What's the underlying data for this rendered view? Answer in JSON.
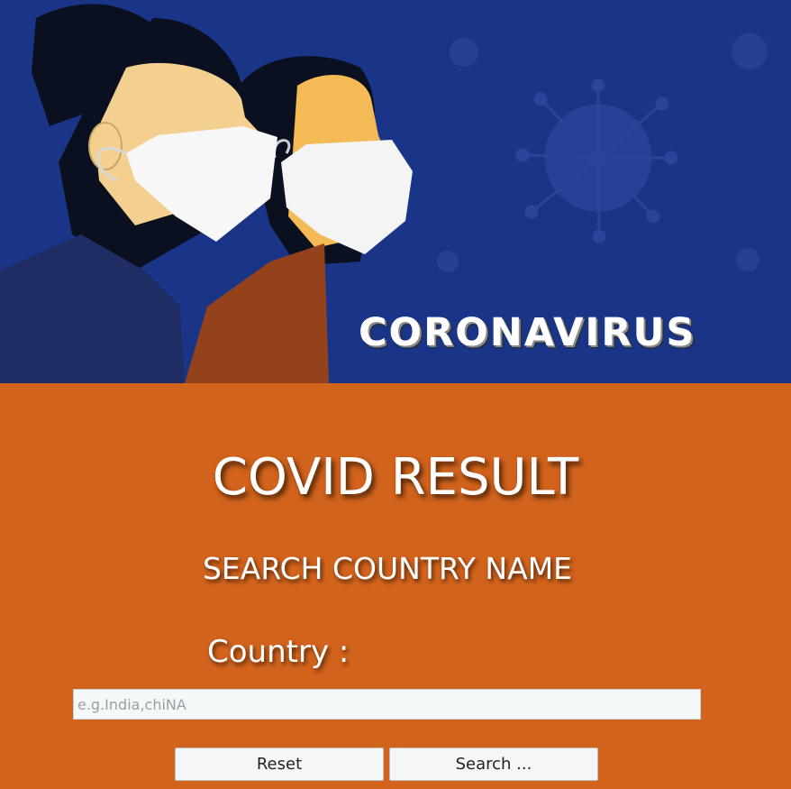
{
  "banner": {
    "title": "CORONAVIRUS",
    "image": "two-people-wearing-face-masks-illustration",
    "background_color": "#1a3587"
  },
  "main": {
    "background_color": "#d2631c",
    "title": "COVID RESULT",
    "subtitle": "SEARCH COUNTRY NAME",
    "country_label": "Country :",
    "country_input": {
      "value": "",
      "placeholder": "e.g.India,chiNA"
    },
    "reset_label": "Reset",
    "search_label": "Search ..."
  }
}
